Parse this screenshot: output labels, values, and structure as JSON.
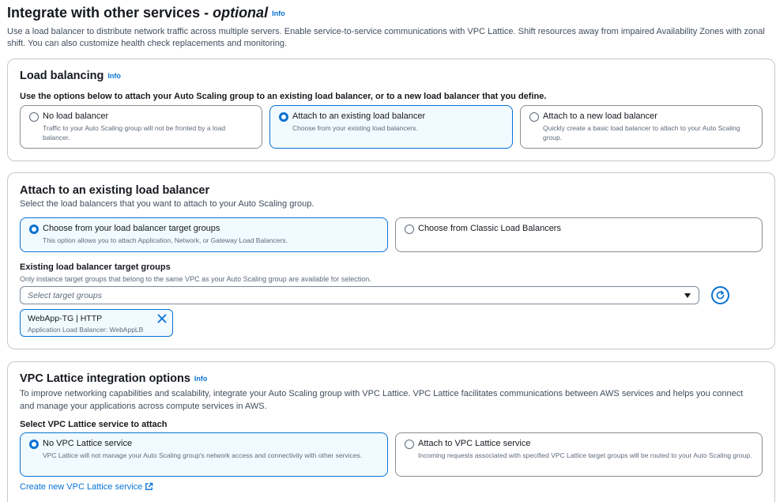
{
  "header": {
    "title": "Integrate with other services - ",
    "title_optional": "optional",
    "info_label": "Info",
    "description": "Use a load balancer to distribute network traffic across multiple servers. Enable service-to-service communications with VPC Lattice. Shift resources away from impaired Availability Zones with zonal shift. You can also customize health check replacements and monitoring."
  },
  "load_balancing": {
    "title": "Load balancing",
    "info_label": "Info",
    "instruction": "Use the options below to attach your Auto Scaling group to an existing load balancer, or to a new load balancer that you define.",
    "options": [
      {
        "label": "No load balancer",
        "description": "Traffic to your Auto Scaling group will not be fronted by a load balancer.",
        "selected": false
      },
      {
        "label": "Attach to an existing load balancer",
        "description": "Choose from your existing load balancers.",
        "selected": true
      },
      {
        "label": "Attach to a new load balancer",
        "description": "Quickly create a basic load balancer to attach to your Auto Scaling group.",
        "selected": false
      }
    ]
  },
  "existing_lb": {
    "title": "Attach to an existing load balancer",
    "description": "Select the load balancers that you want to attach to your Auto Scaling group.",
    "options": [
      {
        "label": "Choose from your load balancer target groups",
        "description": "This option allows you to attach Application, Network, or Gateway Load Balancers.",
        "selected": true
      },
      {
        "label": "Choose from Classic Load Balancers",
        "description": "",
        "selected": false
      }
    ],
    "target_groups_label": "Existing load balancer target groups",
    "target_groups_hint": "Only instance target groups that belong to the same VPC as your Auto Scaling group are available for selection.",
    "select_placeholder": "Select target groups",
    "token": {
      "label": "WebApp-TG | HTTP",
      "description": "Application Load Balancer: WebAppLB"
    }
  },
  "vpc_lattice": {
    "title": "VPC Lattice integration options",
    "info_label": "Info",
    "description": "To improve networking capabilities and scalability, integrate your Auto Scaling group with VPC Lattice. VPC Lattice facilitates communications between AWS services and helps you connect and manage your applications across compute services in AWS.",
    "select_label": "Select VPC Lattice service to attach",
    "options": [
      {
        "label": "No VPC Lattice service",
        "description": "VPC Lattice will not manage your Auto Scaling group's network access and connectivity with other services.",
        "selected": true
      },
      {
        "label": "Attach to VPC Lattice service",
        "description": "Incoming requests associated with specified VPC Lattice target groups will be routed to your Auto Scaling group.",
        "selected": false
      }
    ],
    "create_link": "Create new VPC Lattice service"
  },
  "colors": {
    "accent": "#0972d3",
    "selected_bg": "#f1faff",
    "border": "#c6c6cd"
  },
  "icons": {
    "refresh": "refresh-icon",
    "close": "close-icon",
    "external": "external-link-icon",
    "caret": "caret-down-icon"
  }
}
